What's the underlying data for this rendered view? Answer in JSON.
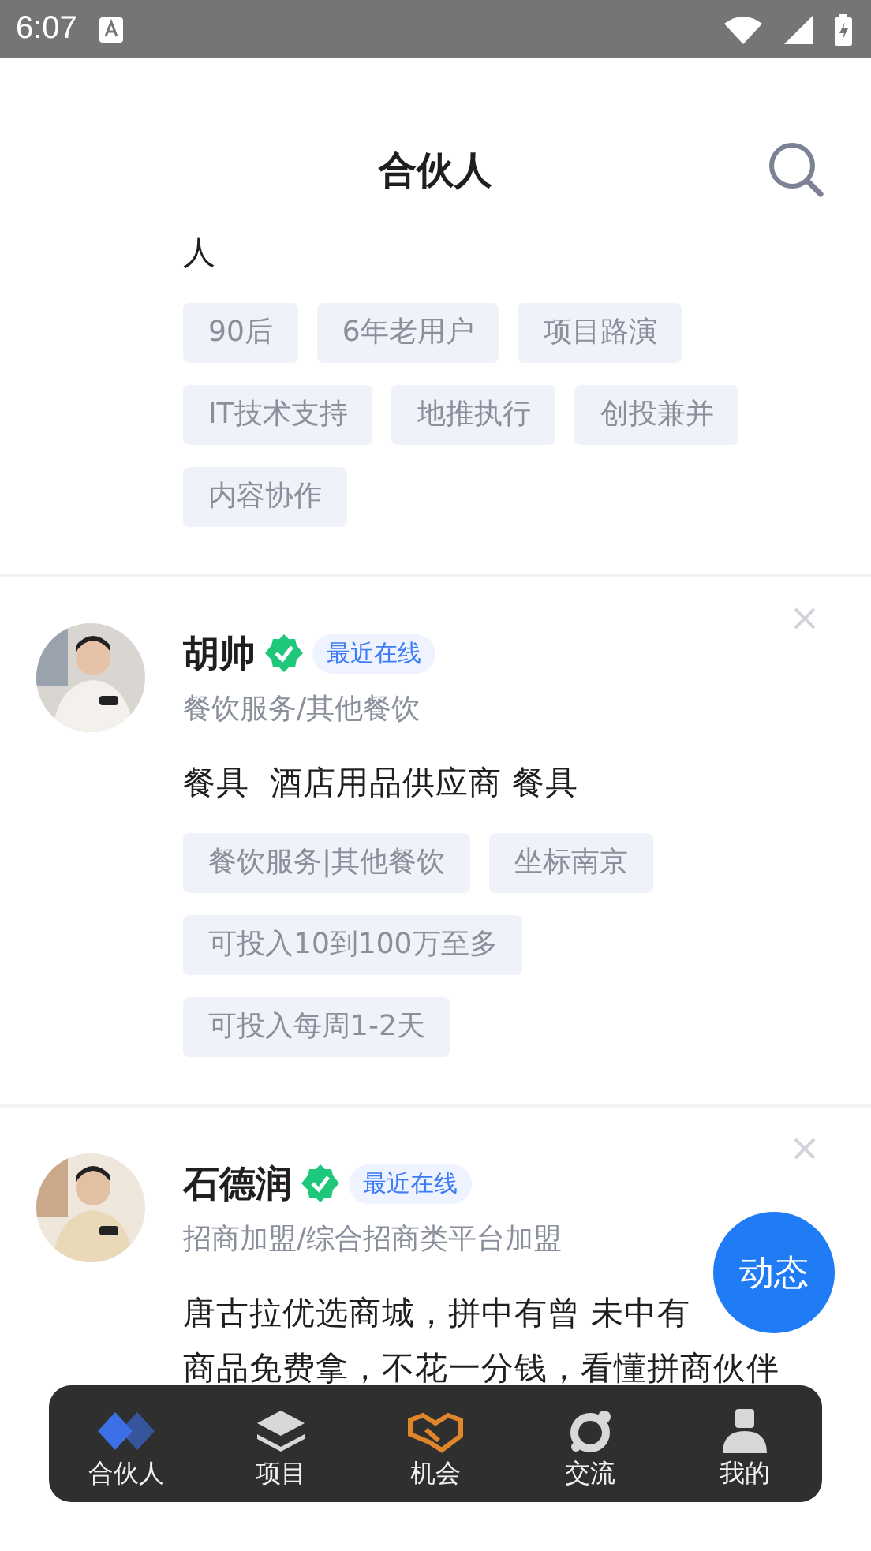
{
  "status_bar": {
    "time": "6:07"
  },
  "header": {
    "title": "合伙人"
  },
  "cards": [
    {
      "description_lines": [
        "人"
      ],
      "tags": [
        "90后",
        "6年老用户",
        "项目路演",
        "IT技术支持",
        "地推执行",
        "创投兼并",
        "内容协作"
      ]
    },
    {
      "name": "胡帅",
      "verified": true,
      "online": "最近在线",
      "industry": "餐饮服务/其他餐饮",
      "description_lines": [
        "餐具  酒店用品供应商 餐具"
      ],
      "tags": [
        "餐饮服务|其他餐饮",
        "坐标南京",
        "可投入10到100万至多",
        "可投入每周1-2天"
      ]
    },
    {
      "name": "石德润",
      "verified": true,
      "online": "最近在线",
      "industry": "招商加盟/综合招商类平台加盟",
      "description_lines": [
        "唐古拉优选商城，拼中有曾 未中有",
        "商品免费拿，不花一分钱，看懂拼商伙伴"
      ]
    }
  ],
  "fab": {
    "label": "动态"
  },
  "tabs": [
    {
      "label": "合伙人",
      "kind": "partner",
      "selected": true
    },
    {
      "label": "项目",
      "kind": "project",
      "selected": false
    },
    {
      "label": "机会",
      "kind": "chance",
      "selected": false
    },
    {
      "label": "交流",
      "kind": "talk",
      "selected": false
    },
    {
      "label": "我的",
      "kind": "me",
      "selected": false
    }
  ]
}
